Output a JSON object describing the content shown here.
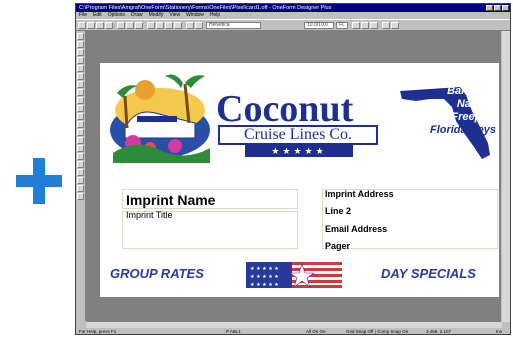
{
  "window": {
    "title": "C:\\Program Files\\Amgraf\\OneForm\\Stationery\\Forms\\OneFiles\\Pixel\\card1.off - OneForm Designer Plus"
  },
  "menu": [
    "File",
    "Edit",
    "Options",
    "Draw",
    "Modify",
    "View",
    "Window",
    "Help"
  ],
  "toolbar": {
    "font_name": "Helvetica",
    "font_size": "10.0/10.0",
    "font_style": "FL"
  },
  "status": {
    "help": "For Help, press F1",
    "pages": "P ABL1",
    "mode": "All On On",
    "snap": "Grid Snap Off | Comp Snap On",
    "coords": "3.456, 2.107",
    "zoom": "Ins"
  },
  "card": {
    "brand": "Coconut",
    "subbrand": "Cruise Lines Co.",
    "stars": "★★★★★",
    "destinations": [
      "Bahamas",
      "Nassau",
      "Freeport",
      "Florida Keys"
    ],
    "imprint_name": "Imprint Name",
    "imprint_title": "Imprint Title",
    "imprint_address": "Imprint Address",
    "line2": "Line 2",
    "email": "Email Address",
    "pager": "Pager",
    "group_rates": "GROUP RATES",
    "day_specials": "DAY SPECIALS"
  },
  "colors": {
    "accent_plus": "#1f7fd6",
    "brand_blue": "#1e2f8f",
    "flag_red": "#d23a3a"
  }
}
